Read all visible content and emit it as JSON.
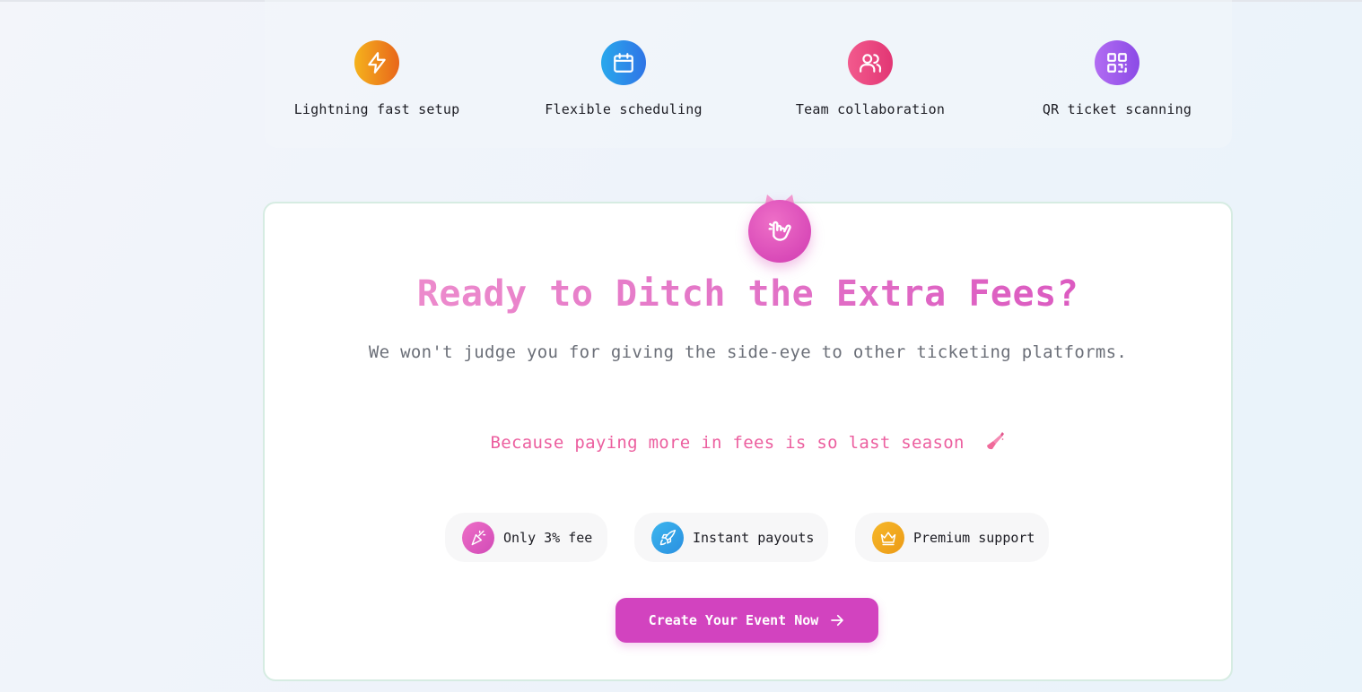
{
  "features": [
    {
      "label": "Lightning fast setup",
      "icon": "lightning-icon",
      "color_from": "#f5b21c",
      "color_to": "#e8661b"
    },
    {
      "label": "Flexible scheduling",
      "icon": "calendar-icon",
      "color_from": "#29a8ec",
      "color_to": "#2f74e6"
    },
    {
      "label": "Team collaboration",
      "icon": "users-icon",
      "color_from": "#f25a8d",
      "color_to": "#e23674"
    },
    {
      "label": "QR ticket scanning",
      "icon": "qr-code-icon",
      "color_from": "#b26cf2",
      "color_to": "#8b4be6"
    }
  ],
  "cta_card": {
    "badge_icon": "party-hand-icon",
    "headline": "Ready to Ditch the Extra Fees?",
    "subline": "We won't judge you for giving the side-eye to other ticketing platforms.",
    "tagline": "Because paying more in fees is so last season",
    "tagline_icon": "nail-polish-icon",
    "perks": [
      {
        "label": "Only 3% fee",
        "icon": "party-popper-icon",
        "color": "#de5bbd"
      },
      {
        "label": "Instant payouts",
        "icon": "rocket-icon",
        "color": "#2fa6e8"
      },
      {
        "label": "Premium support",
        "icon": "crown-icon",
        "color": "#f0a81e"
      }
    ],
    "button_label": "Create Your Event Now",
    "button_icon": "arrow-right-icon"
  },
  "colors": {
    "accent": "#d243bf",
    "headline_gradient_start": "#f195cf",
    "headline_gradient_end": "#d84fbe",
    "tagline": "#ec5f9f",
    "card_border": "#d6ece2"
  }
}
